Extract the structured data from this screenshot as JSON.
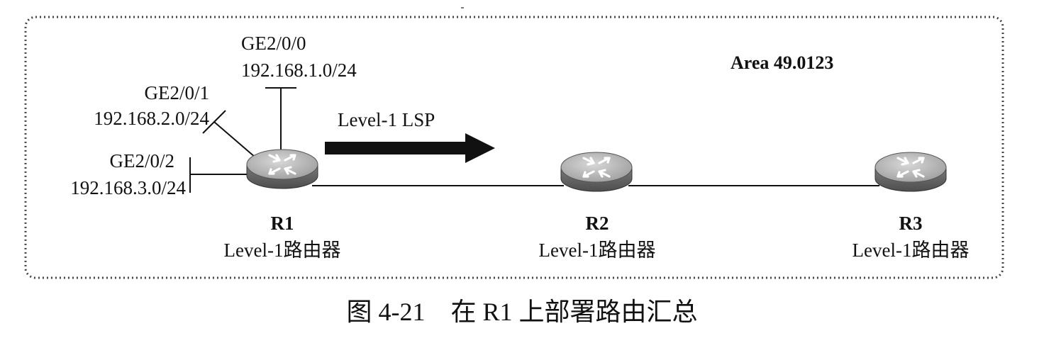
{
  "area": {
    "label": "Area 49.0123"
  },
  "interfaces": [
    {
      "name": "GE2/0/0",
      "network": "192.168.1.0/24"
    },
    {
      "name": "GE2/0/1",
      "network": "192.168.2.0/24"
    },
    {
      "name": "GE2/0/2",
      "network": "192.168.3.0/24"
    }
  ],
  "lsp": {
    "label": "Level-1 LSP"
  },
  "routers": [
    {
      "name": "R1",
      "role": "Level-1路由器"
    },
    {
      "name": "R2",
      "role": "Level-1路由器"
    },
    {
      "name": "R3",
      "role": "Level-1路由器"
    }
  ],
  "caption": "图 4-21　在 R1 上部署路由汇总",
  "colors": {
    "line": "#111111",
    "router_body": "#8f8f8f",
    "router_top": "#c4c4c4",
    "border": "#444444"
  },
  "icons": {
    "router": "router-icon"
  }
}
